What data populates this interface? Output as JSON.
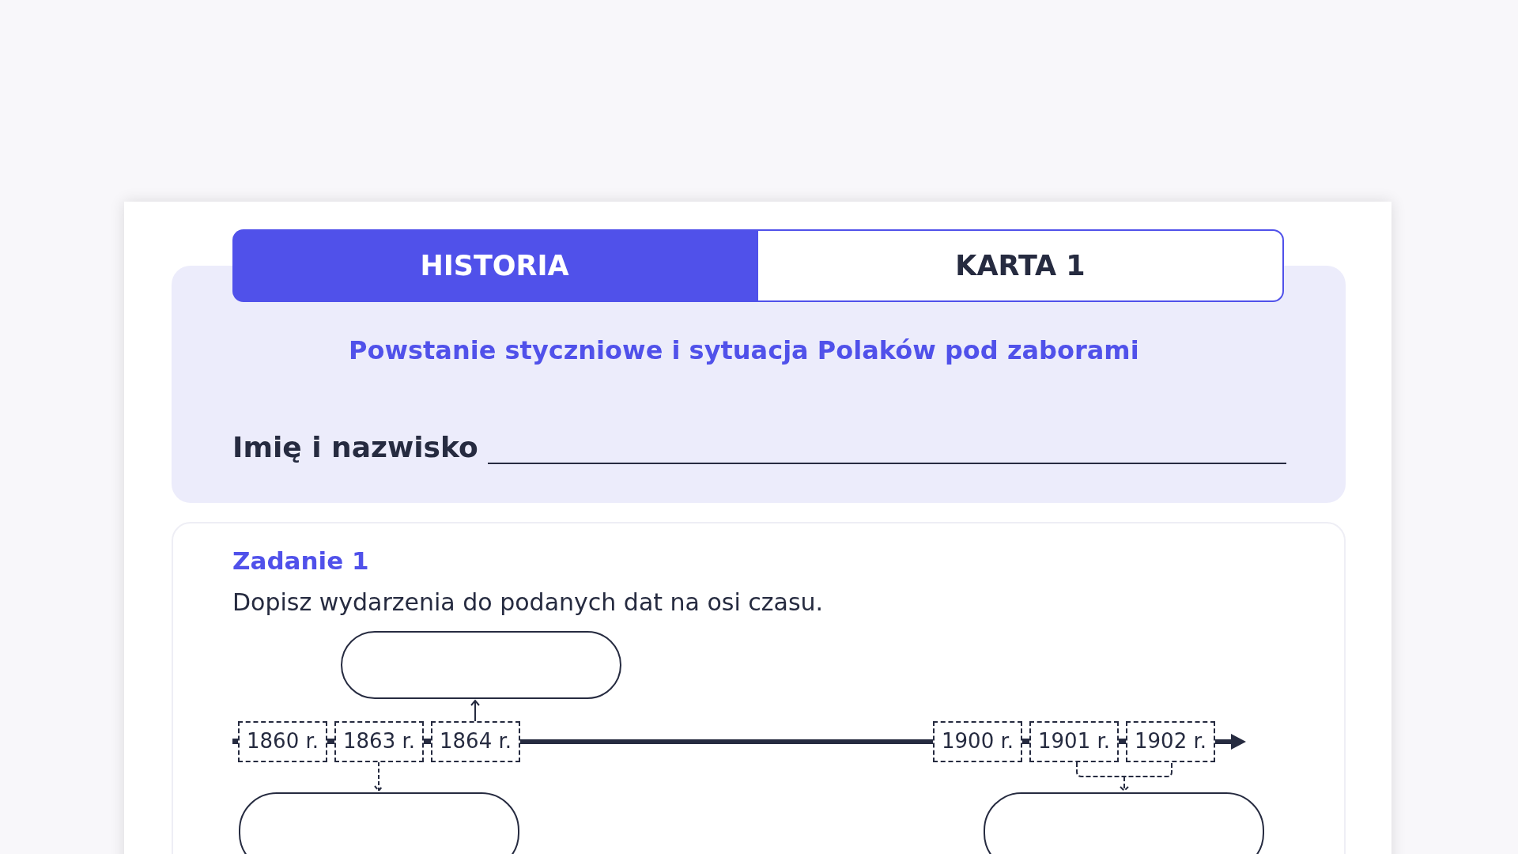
{
  "header": {
    "subject": "HISTORIA",
    "card": "KARTA 1"
  },
  "title": "Powstanie styczniowe i sytuacja Polaków pod zaborami",
  "name_label": "Imię i nazwisko",
  "task": {
    "title": "Zadanie 1",
    "instruction": "Dopisz wydarzenia do podanych dat na osi czasu.",
    "timeline": {
      "groups": [
        [
          "1860 r.",
          "1863 r.",
          "1864 r."
        ],
        [
          "1900 r.",
          "1901 r.",
          "1902 r."
        ]
      ]
    }
  }
}
